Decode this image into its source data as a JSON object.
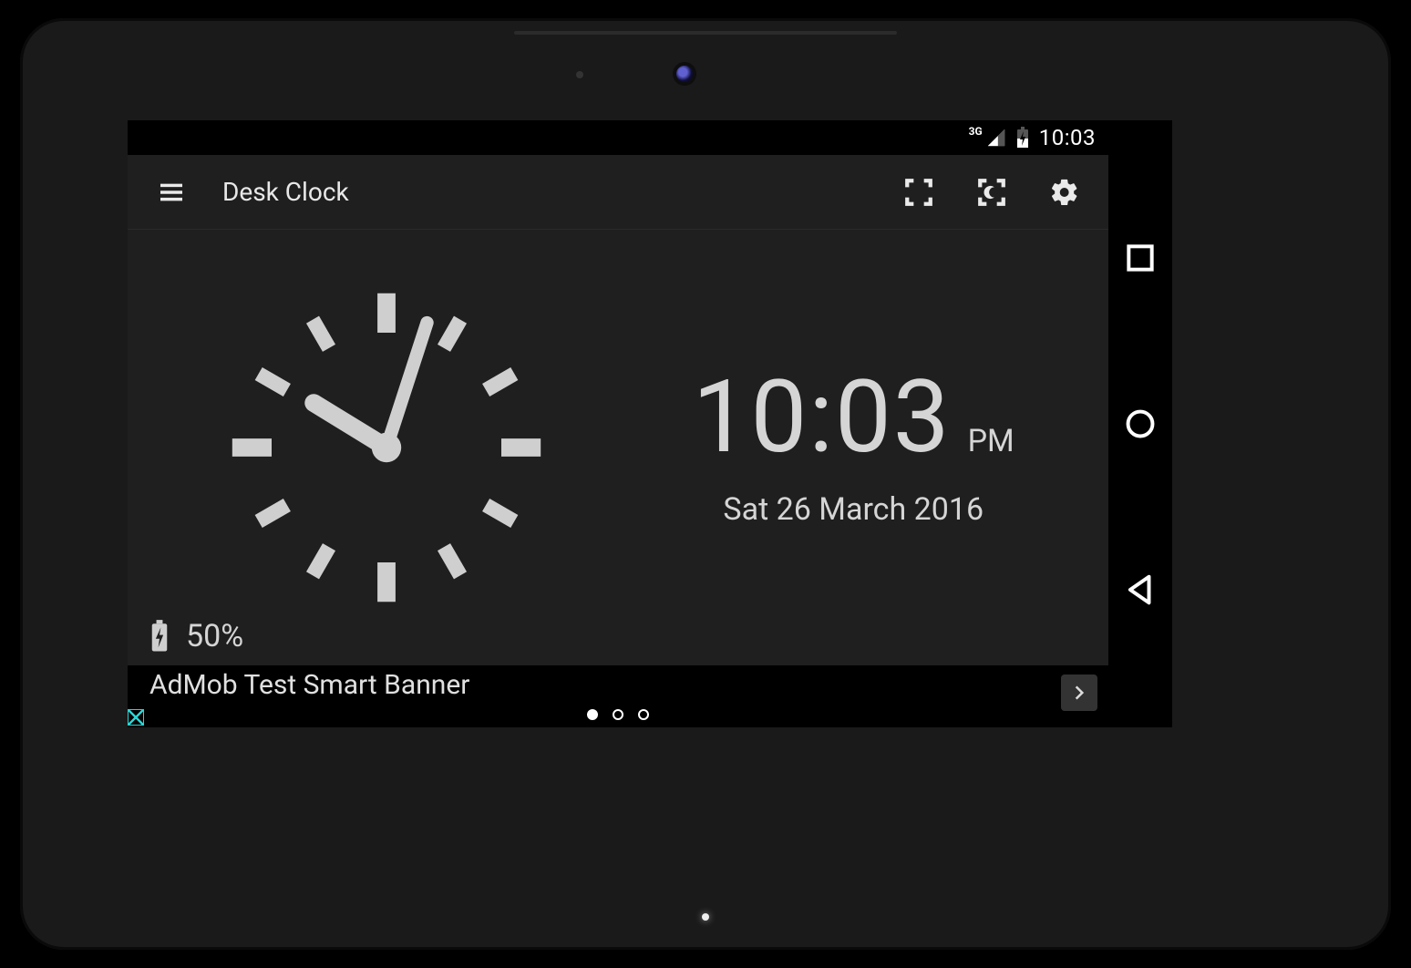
{
  "statusbar": {
    "network_label": "3G",
    "time": "10:03"
  },
  "toolbar": {
    "title": "Desk Clock"
  },
  "clock": {
    "time": "10:03",
    "ampm": "PM",
    "date": "Sat 26 March 2016",
    "hour": 10,
    "minute": 3
  },
  "battery": {
    "percent_label": "50%"
  },
  "ad": {
    "text": "AdMob Test Smart Banner"
  },
  "pager": {
    "count": 3,
    "current": 0
  }
}
